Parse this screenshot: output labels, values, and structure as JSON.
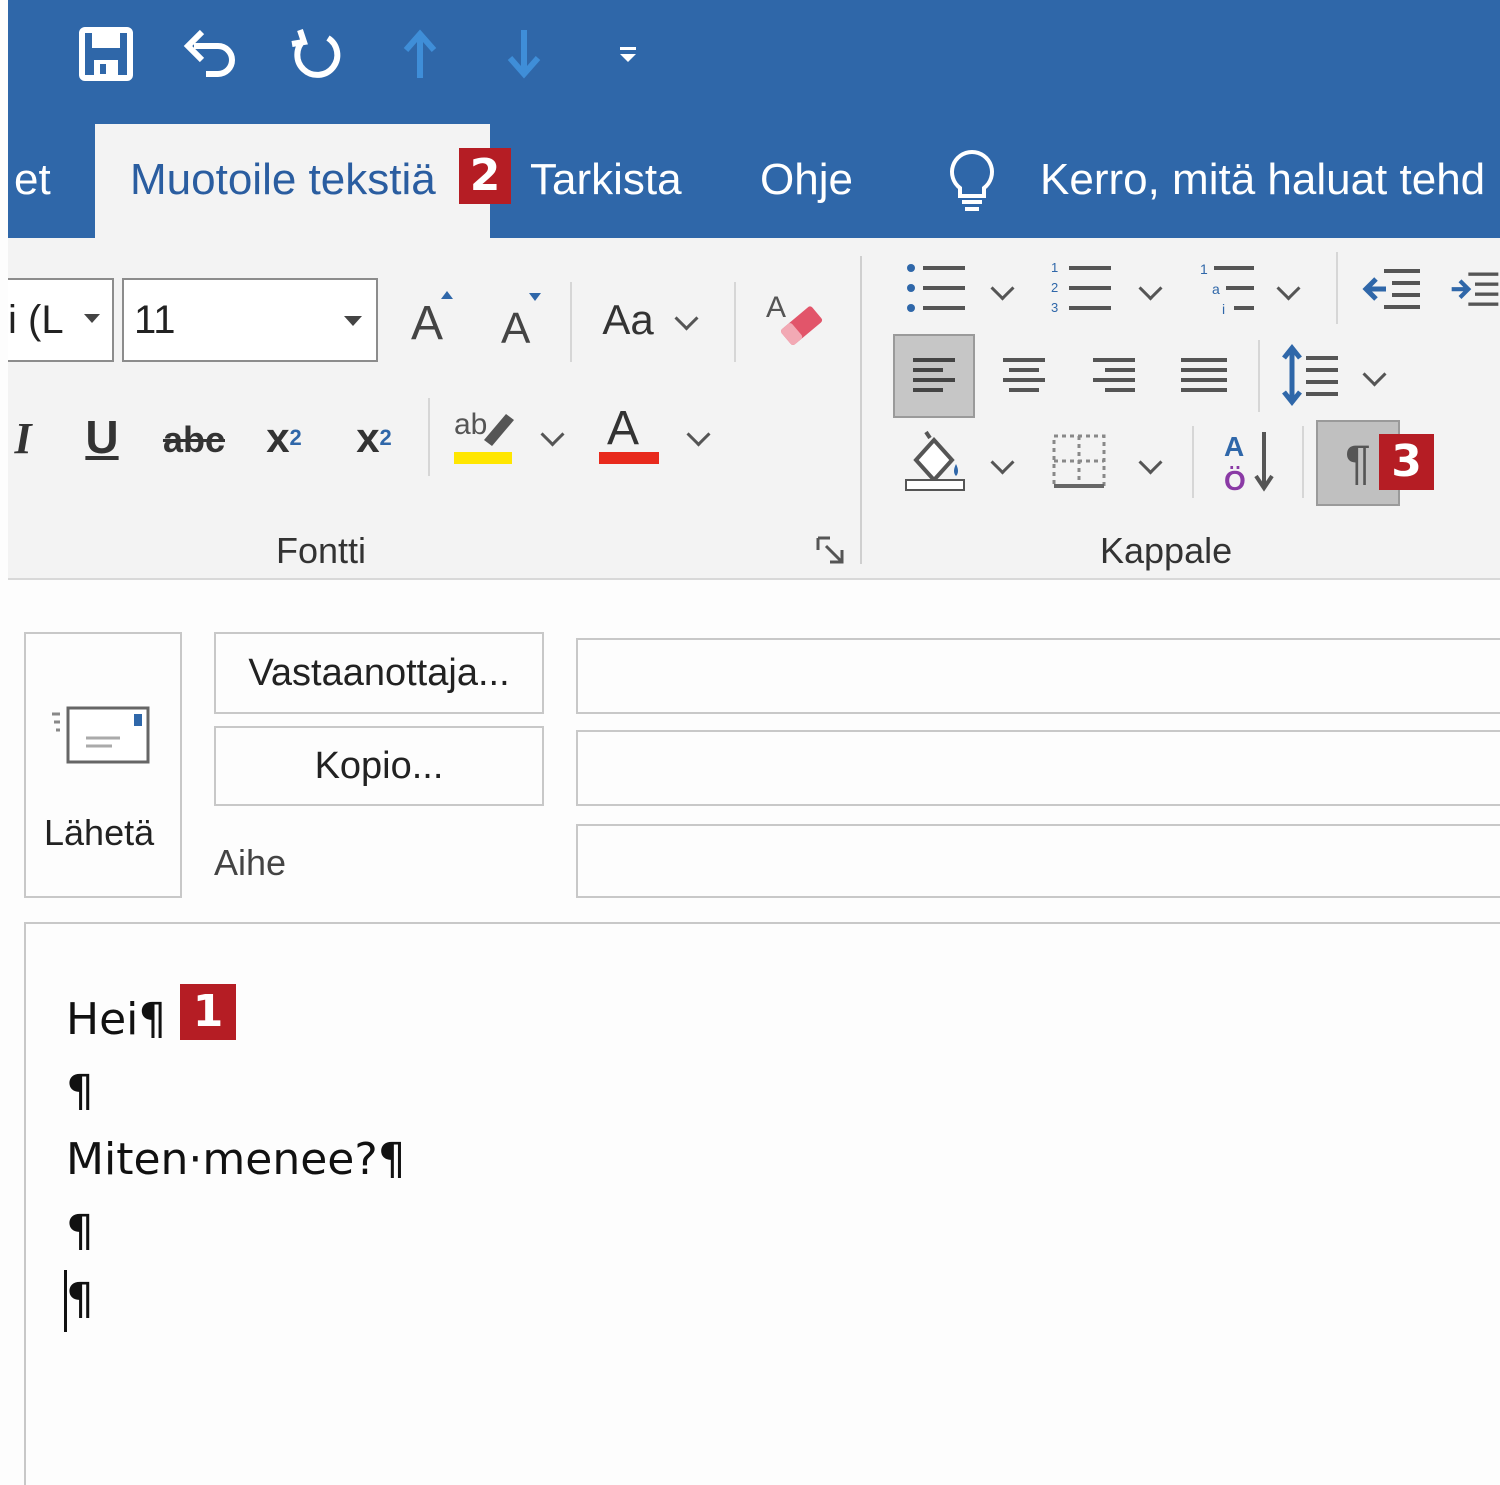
{
  "qat": {
    "icons": [
      "save-icon",
      "undo-icon",
      "redo-icon",
      "arrow-up-icon",
      "arrow-down-icon",
      "customize-icon"
    ]
  },
  "tabs": {
    "partial": "et",
    "active": "Muotoile tekstiä",
    "review": "Tarkista",
    "help": "Ohje",
    "tell_me": "Kerro, mitä haluat tehd"
  },
  "badges": {
    "b1": "1",
    "b2": "2",
    "b3": "3"
  },
  "font_group": {
    "font_name": "i (L",
    "font_size": "11",
    "change_case": "Aa",
    "underline": "U",
    "strike": "abc",
    "subscript": "x",
    "subscript_sub": "2",
    "superscript": "x",
    "superscript_sup": "2",
    "italic": "I",
    "font_color_letter": "A",
    "highlight_letters": "ab",
    "label": "Fontti"
  },
  "paragraph_group": {
    "label": "Kappale",
    "pilcrow": "¶"
  },
  "compose": {
    "send": "Lähetä",
    "to_button": "Vastaanottaja...",
    "cc_button": "Kopio...",
    "subject_label": "Aihe",
    "to_value": "",
    "cc_value": "",
    "subject_value": ""
  },
  "body": {
    "lines": [
      "Hei¶",
      "¶",
      "Miten·menee?¶",
      "¶",
      "¶"
    ]
  },
  "colors": {
    "title_blue": "#2f67a9",
    "badge_red": "#b51d24",
    "highlight_yellow": "#ffe600",
    "font_color_red": "#e8291c"
  }
}
